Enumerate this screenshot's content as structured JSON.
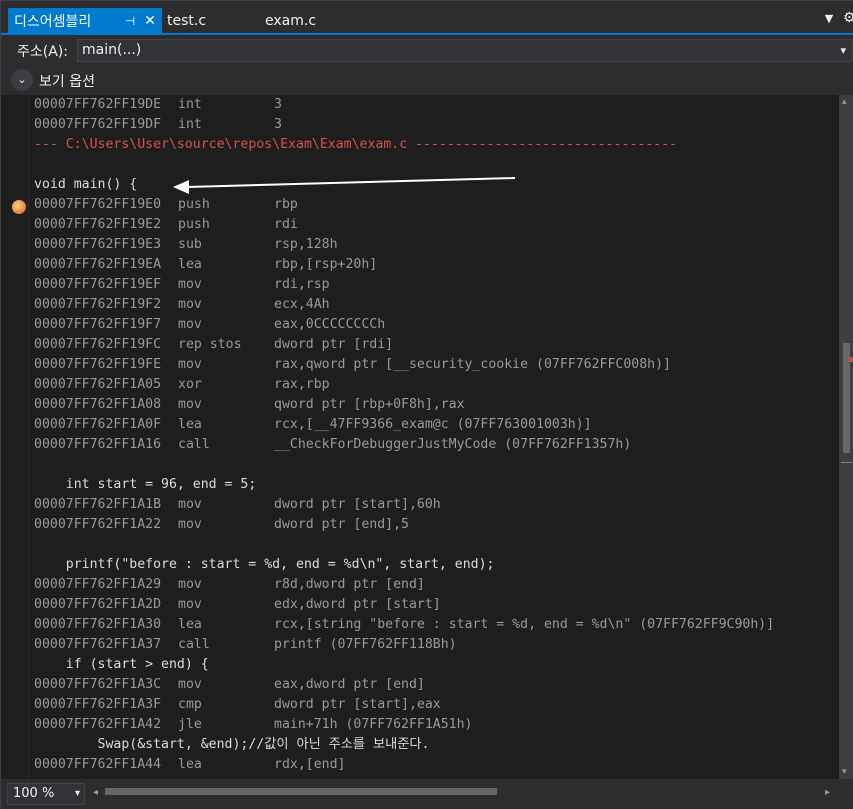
{
  "tabs": {
    "active_label": "디스어셈블리",
    "pin_glyph": "⊣",
    "close_glyph": "✕",
    "other": [
      "test.c",
      "exam.c"
    ],
    "dropdown_glyph": "▼",
    "gear_glyph": "⚙"
  },
  "address": {
    "label": "주소(A):",
    "value": "main(...)",
    "chevron": "▾"
  },
  "options": {
    "toggle_glyph": "⌄",
    "label": "보기 옵션"
  },
  "code_lines": [
    {
      "kind": "asm",
      "addr": "00007FF762FF19DE",
      "mn": "int",
      "op": "3"
    },
    {
      "kind": "asm",
      "addr": "00007FF762FF19DF",
      "mn": "int",
      "op": "3"
    },
    {
      "kind": "file",
      "text": "--- C:\\Users\\User\\source\\repos\\Exam\\Exam\\exam.c ---------------------------------"
    },
    {
      "kind": "blank",
      "text": ""
    },
    {
      "kind": "src",
      "text": "void main() {"
    },
    {
      "kind": "asm",
      "addr": "00007FF762FF19E0",
      "mn": "push",
      "op": "rbp"
    },
    {
      "kind": "asm",
      "addr": "00007FF762FF19E2",
      "mn": "push",
      "op": "rdi"
    },
    {
      "kind": "asm",
      "addr": "00007FF762FF19E3",
      "mn": "sub",
      "op": "rsp,128h"
    },
    {
      "kind": "asm",
      "addr": "00007FF762FF19EA",
      "mn": "lea",
      "op": "rbp,[rsp+20h]"
    },
    {
      "kind": "asm",
      "addr": "00007FF762FF19EF",
      "mn": "mov",
      "op": "rdi,rsp"
    },
    {
      "kind": "asm",
      "addr": "00007FF762FF19F2",
      "mn": "mov",
      "op": "ecx,4Ah"
    },
    {
      "kind": "asm",
      "addr": "00007FF762FF19F7",
      "mn": "mov",
      "op": "eax,0CCCCCCCCh"
    },
    {
      "kind": "asm",
      "addr": "00007FF762FF19FC",
      "mn": "rep stos",
      "op": "dword ptr [rdi]"
    },
    {
      "kind": "asm",
      "addr": "00007FF762FF19FE",
      "mn": "mov",
      "op": "rax,qword ptr [__security_cookie (07FF762FFC008h)]"
    },
    {
      "kind": "asm",
      "addr": "00007FF762FF1A05",
      "mn": "xor",
      "op": "rax,rbp"
    },
    {
      "kind": "asm",
      "addr": "00007FF762FF1A08",
      "mn": "mov",
      "op": "qword ptr [rbp+0F8h],rax"
    },
    {
      "kind": "asm",
      "addr": "00007FF762FF1A0F",
      "mn": "lea",
      "op": "rcx,[__47FF9366_exam@c (07FF763001003h)]"
    },
    {
      "kind": "asm",
      "addr": "00007FF762FF1A16",
      "mn": "call",
      "op": "__CheckForDebuggerJustMyCode (07FF762FF1357h)"
    },
    {
      "kind": "blank",
      "text": ""
    },
    {
      "kind": "src",
      "text": "    int start = 96, end = 5;"
    },
    {
      "kind": "asm",
      "addr": "00007FF762FF1A1B",
      "mn": "mov",
      "op": "dword ptr [start],60h"
    },
    {
      "kind": "asm",
      "addr": "00007FF762FF1A22",
      "mn": "mov",
      "op": "dword ptr [end],5"
    },
    {
      "kind": "blank",
      "text": ""
    },
    {
      "kind": "src",
      "text": "    printf(\"before : start = %d, end = %d\\n\", start, end);"
    },
    {
      "kind": "asm",
      "addr": "00007FF762FF1A29",
      "mn": "mov",
      "op": "r8d,dword ptr [end]"
    },
    {
      "kind": "asm",
      "addr": "00007FF762FF1A2D",
      "mn": "mov",
      "op": "edx,dword ptr [start]"
    },
    {
      "kind": "asm",
      "addr": "00007FF762FF1A30",
      "mn": "lea",
      "op": "rcx,[string \"before : start = %d, end = %d\\n\" (07FF762FF9C90h)]"
    },
    {
      "kind": "asm",
      "addr": "00007FF762FF1A37",
      "mn": "call",
      "op": "printf (07FF762FF118Bh)"
    },
    {
      "kind": "src",
      "text": "    if (start > end) {"
    },
    {
      "kind": "asm",
      "addr": "00007FF762FF1A3C",
      "mn": "mov",
      "op": "eax,dword ptr [end]"
    },
    {
      "kind": "asm",
      "addr": "00007FF762FF1A3F",
      "mn": "cmp",
      "op": "dword ptr [start],eax"
    },
    {
      "kind": "asm",
      "addr": "00007FF762FF1A42",
      "mn": "jle",
      "op": "main+71h (07FF762FF1A51h)"
    },
    {
      "kind": "src",
      "text": "        Swap(&start, &end);//값이 아닌 주소를 보내준다."
    },
    {
      "kind": "asm",
      "addr": "00007FF762FF1A44",
      "mn": "lea",
      "op": "rdx,[end]"
    }
  ],
  "status": {
    "zoom": "100 %",
    "zoom_chevron": "▾",
    "scroll_left": "◂",
    "scroll_right": "▸",
    "scroll_up": "▴",
    "scroll_down": "▾"
  },
  "colors": {
    "accent": "#007acc",
    "file_header": "#d85050",
    "annotation_arrow": "#ffffff"
  }
}
